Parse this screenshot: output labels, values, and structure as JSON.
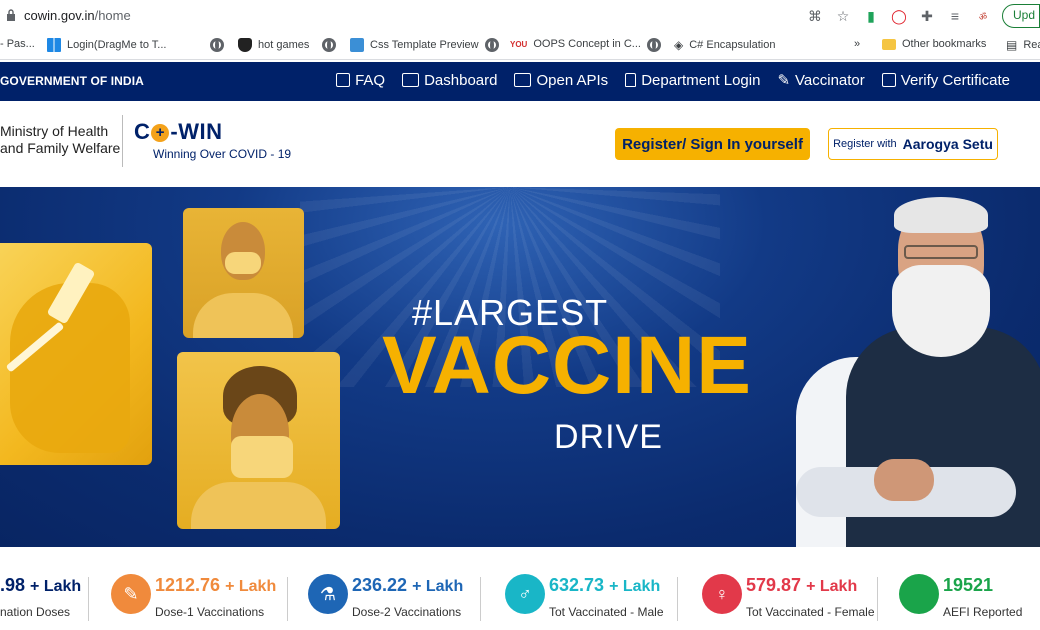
{
  "browser": {
    "url_host": "cowin.gov.in",
    "url_path": "/home",
    "update_label": "Upd"
  },
  "bookmarks": [
    {
      "label": "- Pas...",
      "icon": "none"
    },
    {
      "label": "Login(DragMe to T...",
      "icon": "globe-icon"
    },
    {
      "label": "hot games",
      "icon": "shield-icon"
    },
    {
      "label": "Css Template Preview",
      "icon": "globe-icon"
    },
    {
      "label": "OOPS Concept in C...",
      "icon": "youtube-icon"
    },
    {
      "label": "C# Encapsulation",
      "icon": "globe-icon"
    },
    {
      "label": "Other bookmarks",
      "icon": "folder-icon"
    },
    {
      "label": "Rea",
      "icon": "reading-list-icon"
    }
  ],
  "gov": {
    "title": "GOVERNMENT OF INDIA",
    "nav": [
      {
        "label": "FAQ",
        "icon": "faq-icon"
      },
      {
        "label": "Dashboard",
        "icon": "dashboard-icon"
      },
      {
        "label": "Open APIs",
        "icon": "api-icon"
      },
      {
        "label": "Department Login",
        "icon": "lock-icon"
      },
      {
        "label": "Vaccinator",
        "icon": "syringe-icon"
      },
      {
        "label": "Verify Certificate",
        "icon": "certificate-icon"
      }
    ]
  },
  "header": {
    "ministry_line1": "Ministry of Health",
    "ministry_line2": "and Family Welfare",
    "logo_co": "C",
    "logo_plus": "+",
    "logo_rest": "-WIN",
    "tagline": "Winning Over COVID - 19",
    "register_label": "Register/ Sign In yourself",
    "aarogya_small": "Register with",
    "aarogya_big": "Aarogya Setu"
  },
  "hero": {
    "line1": "#LARGEST",
    "line2": "VACCINE",
    "line3": "DRIVE"
  },
  "stats": [
    {
      "value": ".98",
      "unit": "+ Lakh",
      "label": "nation Doses",
      "color": "#002169",
      "icon": "none"
    },
    {
      "value": "1212.76",
      "unit": "+ Lakh",
      "label": "Dose-1 Vaccinations",
      "color": "#f08a3c",
      "icon": "syringe-icon"
    },
    {
      "value": "236.22",
      "unit": "+ Lakh",
      "label": "Dose-2 Vaccinations",
      "color": "#1e66b5",
      "icon": "vials-icon"
    },
    {
      "value": "632.73",
      "unit": "+ Lakh",
      "label": "Tot Vaccinated - Male",
      "color": "#19b6c7",
      "icon": "male-icon"
    },
    {
      "value": "579.87",
      "unit": "+ Lakh",
      "label": "Tot Vaccinated - Female",
      "color": "#e2394a",
      "icon": "female-icon"
    },
    {
      "value": "19521",
      "unit": "",
      "label": "AEFI Reported",
      "color": "#1aa44a",
      "icon": "circle-icon"
    }
  ],
  "colors": {
    "gov_bar": "#002169",
    "accent": "#f6b100"
  }
}
